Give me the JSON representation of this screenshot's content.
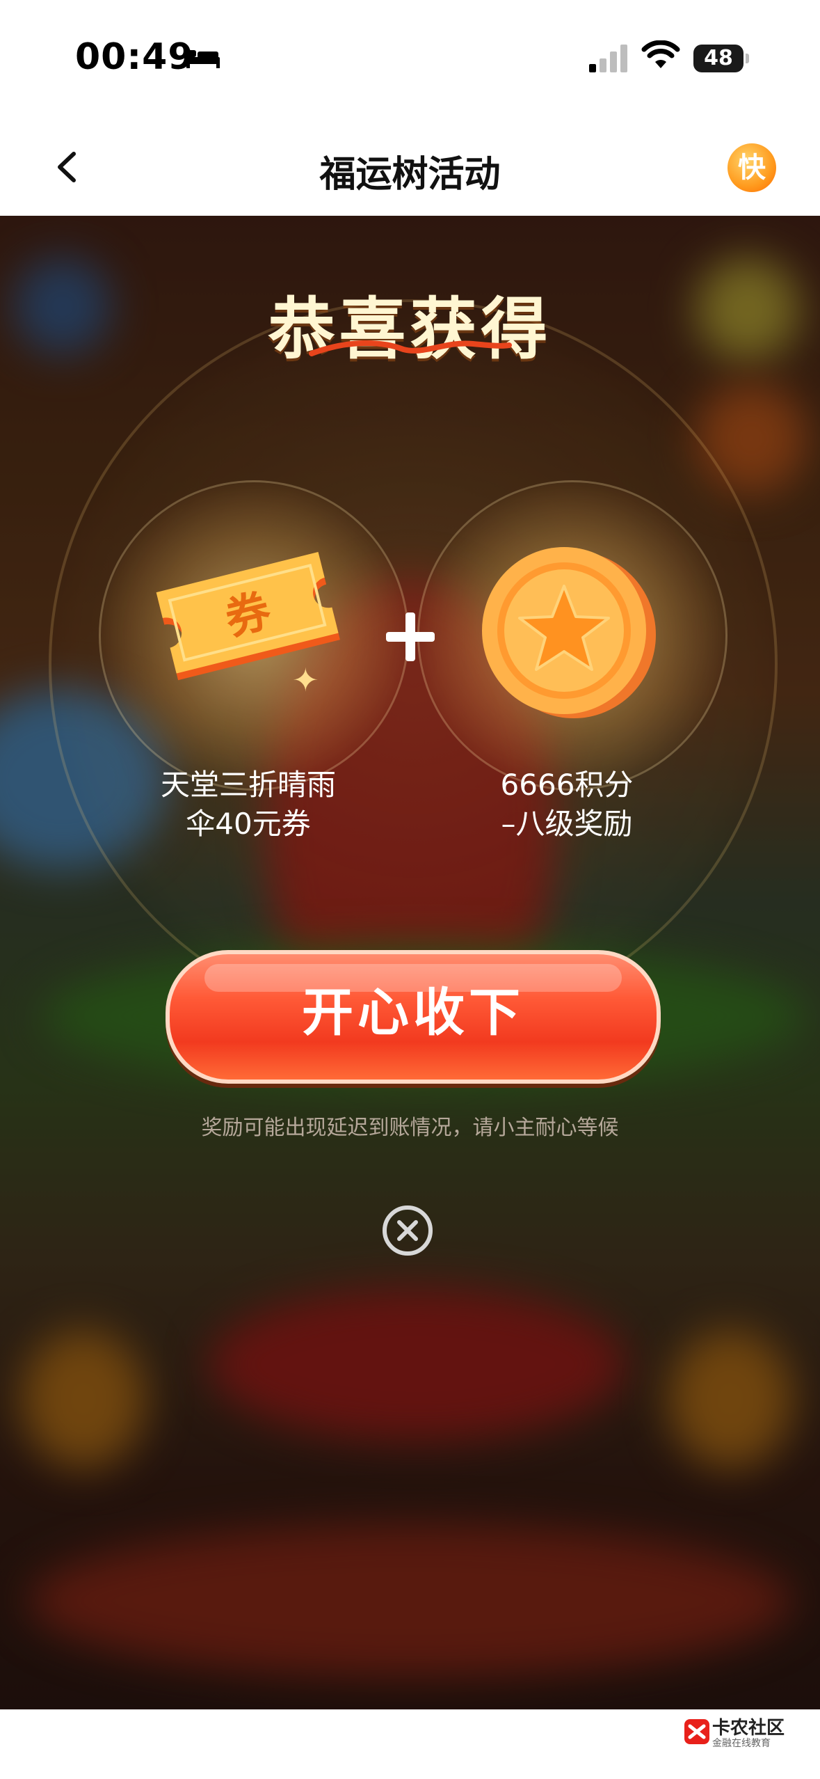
{
  "status_bar": {
    "time": "00:49",
    "battery": "48"
  },
  "nav": {
    "title": "福运树活动",
    "badge": "快"
  },
  "modal": {
    "heading": "恭喜获得",
    "prizes": [
      {
        "line1": "天堂三折晴雨",
        "line2": "伞40元券",
        "icon": "coupon-ticket",
        "icon_text": "券"
      },
      {
        "line1": "6666积分",
        "line2": "–八级奖励",
        "icon": "star-coin"
      }
    ],
    "button_label": "开心收下",
    "note": "奖励可能出现延迟到账情况，请小主耐心等候"
  },
  "watermark": {
    "name": "卡农社区",
    "sub": "金融在线教育"
  }
}
